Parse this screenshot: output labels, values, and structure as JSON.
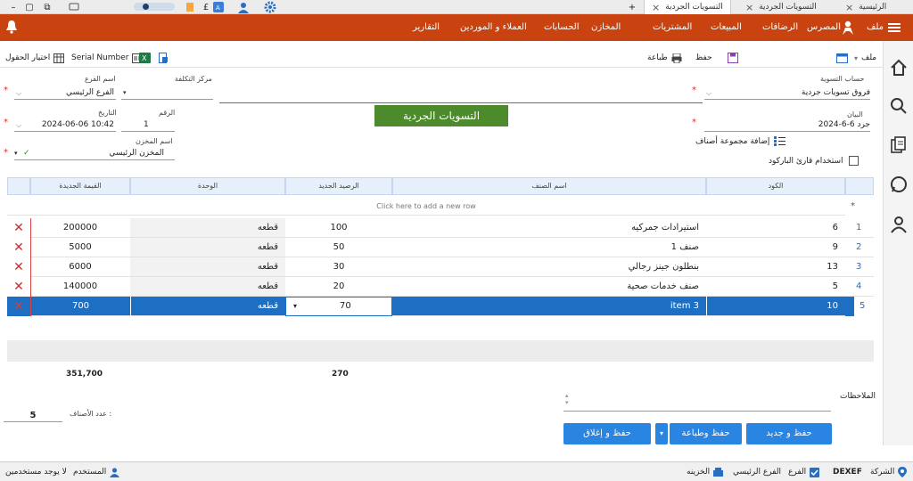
{
  "tabs": [
    {
      "label": "الرئيسية"
    },
    {
      "label": "التسويات الجردية"
    },
    {
      "label": "التسويات الجردية"
    }
  ],
  "nav": {
    "file": "ملف",
    "items": [
      "المصرس",
      "الرضافات",
      "المبيعات",
      "المشتريات",
      "المخازن",
      "الحسابات",
      "العملاء و الموردين",
      "التقارير"
    ]
  },
  "toolbar": {
    "file": "ملف",
    "save": "حفظ",
    "print": "طباعة",
    "serial": "Serial Number",
    "choose_fields": "اختيار الحقول"
  },
  "form": {
    "title": "التسويات الجردية",
    "adjust_account_label": "حساب التسوية",
    "adjust_account_value": "فروق تسويات جردية",
    "cost_center_label": "مركز التكلفة",
    "branch_label": "اسم الفرع",
    "branch_value": "الفرع الرئيسي",
    "statement_label": "البيان",
    "statement_value": "جرد 6-6-2024",
    "number_label": "الرقم",
    "number_value": "1",
    "date_label": "التاريخ",
    "date_value": "2024-06-06 10:42",
    "store_label": "اسم المخزن",
    "store_value": "المخزن الرئيسي",
    "add_group": "إضافة مجموعة أصناف",
    "barcode_reader": "استخدام قارئ الباركود"
  },
  "grid": {
    "columns": {
      "code": "الكود",
      "item": "اسم الصنف",
      "new_balance": "الرصيد الجديد",
      "unit": "الوحدة",
      "new_value": "القيمة الجديدة"
    },
    "new_row_hint": "Click here to add a new row",
    "rows": [
      {
        "n": "1",
        "code": "6",
        "item": "استيرادات جمركيه",
        "balance": "100",
        "unit": "قطعه",
        "value": "200000"
      },
      {
        "n": "2",
        "code": "9",
        "item": "صنف 1",
        "balance": "50",
        "unit": "قطعه",
        "value": "5000"
      },
      {
        "n": "3",
        "code": "13",
        "item": "بنطلون جينز رجالي",
        "balance": "30",
        "unit": "قطعه",
        "value": "6000"
      },
      {
        "n": "4",
        "code": "5",
        "item": "صنف خدمات صحية",
        "balance": "20",
        "unit": "قطعه",
        "value": "140000"
      },
      {
        "n": "5",
        "code": "10",
        "item": "item 3",
        "balance": "70",
        "unit": "قطعه",
        "value": "700",
        "selected": true
      }
    ],
    "total_value": "351,700",
    "total_balance": "270"
  },
  "notes_label": "الملاحظات",
  "items_count_label": "عدد الأصناف :",
  "items_count_value": "5",
  "buttons": {
    "save_new": "حفظ و جديد",
    "save_print": "حفظ وطباعة",
    "save_close": "حفظ و إغلاق"
  },
  "status": {
    "company": "الشركة",
    "company_code": "DEXEF",
    "branch": "الفرع",
    "branch_value": "الفرع الرئيسي",
    "treasury": "الخزينه",
    "user": "المستخدم",
    "no_users": "لا يوجد مستخدمين"
  },
  "colors": {
    "nav": "#c8430f",
    "selected_row": "#1d6fc4",
    "button": "#2a84e2",
    "title_box": "#4c8a2c"
  }
}
